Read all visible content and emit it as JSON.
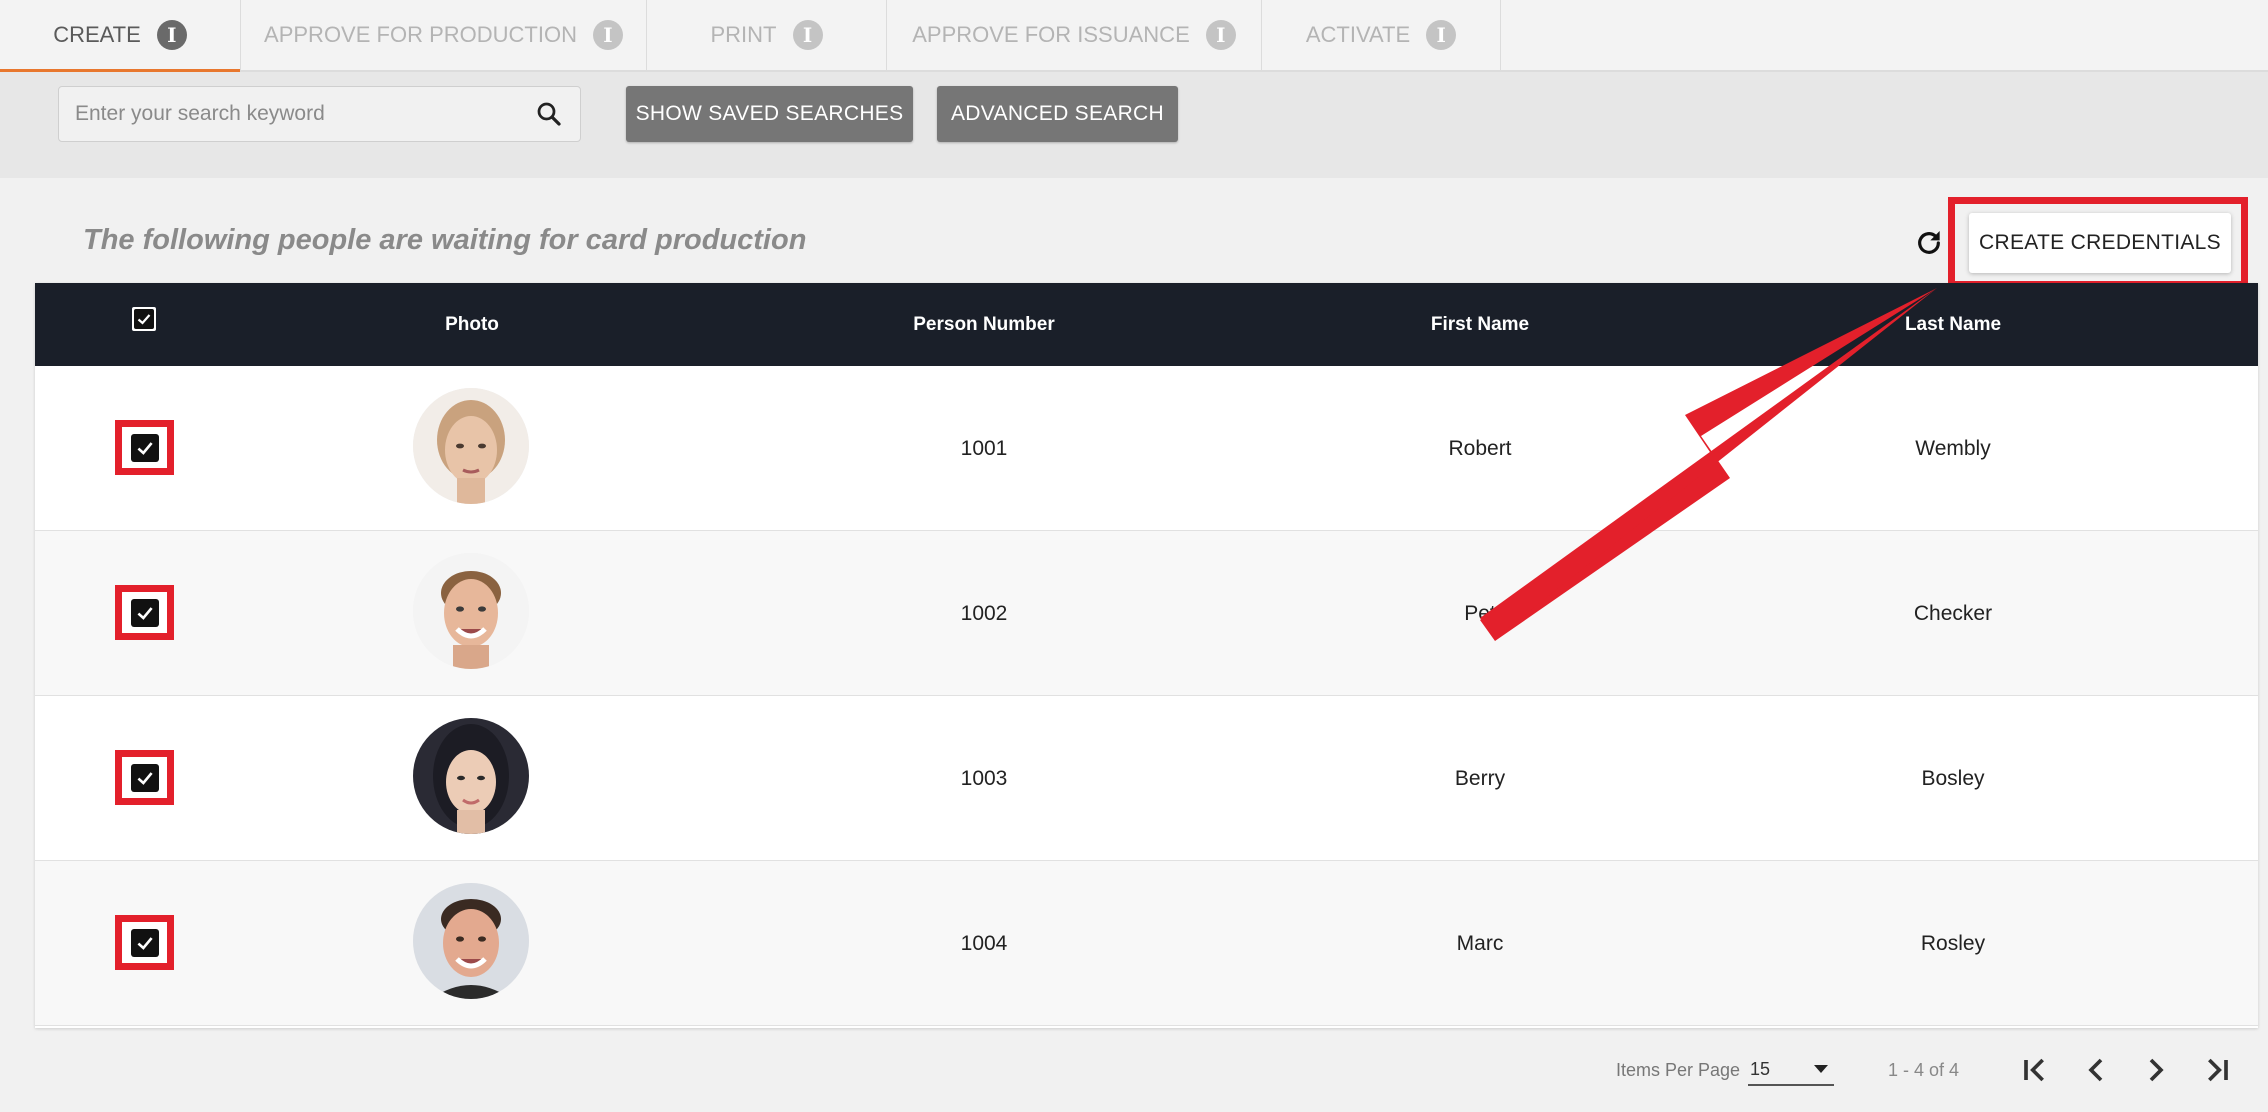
{
  "tabs": [
    {
      "label": "CREATE",
      "active": true
    },
    {
      "label": "APPROVE FOR PRODUCTION",
      "active": false
    },
    {
      "label": "PRINT",
      "active": false
    },
    {
      "label": "APPROVE FOR ISSUANCE",
      "active": false
    },
    {
      "label": "ACTIVATE",
      "active": false
    }
  ],
  "tab_info_glyph": "i",
  "search": {
    "placeholder": "Enter your search keyword",
    "value": "",
    "saved_searches_label": "SHOW SAVED SEARCHES",
    "advanced_search_label": "ADVANCED SEARCH"
  },
  "page_title": "The following people are waiting for card production",
  "create_credentials_label": "CREATE CREDENTIALS",
  "table": {
    "headers": [
      "Photo",
      "Person Number",
      "First Name",
      "Last Name"
    ],
    "header_checked": true,
    "rows": [
      {
        "checked": true,
        "photo": "female-light-hair-photo",
        "person_number": "1001",
        "first_name": "Robert",
        "last_name": "Wembly"
      },
      {
        "checked": true,
        "photo": "male-smiling-photo",
        "person_number": "1002",
        "first_name": "Pet",
        "last_name": "Checker"
      },
      {
        "checked": true,
        "photo": "female-dark-hair-photo",
        "person_number": "1003",
        "first_name": "Berry",
        "last_name": "Bosley"
      },
      {
        "checked": true,
        "photo": "male-dark-hair-photo",
        "person_number": "1004",
        "first_name": "Marc",
        "last_name": "Rosley"
      }
    ]
  },
  "pagination": {
    "items_per_page_label": "Items Per Page",
    "items_per_page": "15",
    "range": "1 - 4 of 4"
  },
  "colors": {
    "accent_tab": "#e8772e",
    "annotation_red": "#e3202b",
    "table_header": "#1a1f29",
    "button_gray": "#767676"
  },
  "icons": [
    "info-icon",
    "search-icon",
    "refresh-icon",
    "checkbox-checked-icon",
    "first-page-icon",
    "prev-page-icon",
    "next-page-icon",
    "last-page-icon",
    "annotation-arrow"
  ]
}
